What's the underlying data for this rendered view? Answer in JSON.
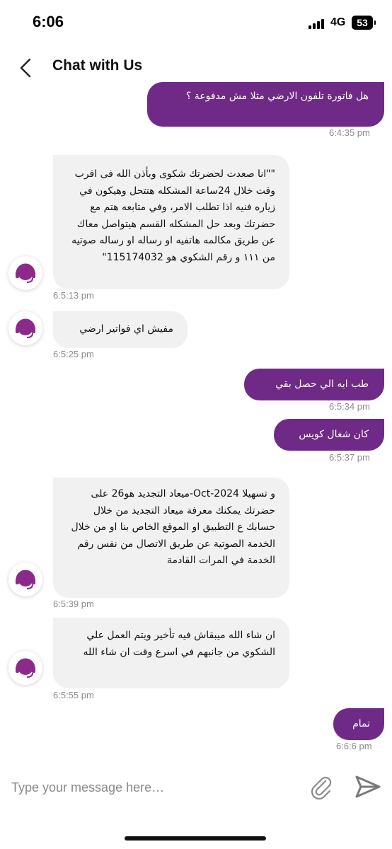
{
  "status_bar": {
    "time": "6:06",
    "network": "4G",
    "battery": "53"
  },
  "header": {
    "title": "Chat with Us",
    "back_icon": "chevron-left-icon"
  },
  "messages": [
    {
      "direction": "out",
      "text": "هل فاتورة تلفون الارضي مثلا مش مدفوعة ؟",
      "time": "6:4:35 pm"
    },
    {
      "direction": "in",
      "text": "\"\"انا صعدت لحضرتك شكوى وبأذن الله فى اقرب وقت خلال 24ساعة المشكله هتتحل وهيكون في زياره فنيه اذا تطلب الامر، وفي متابعه هتم مع حضرتك وبعد حل المشكله القسم هيتواصل معاك عن طريق مكالمه هاتفيه او رساله او رساله صوتيه من ١١١ و رقم الشكوي هو 115174032\"",
      "time": "6:5:13 pm"
    },
    {
      "direction": "in",
      "text": "مفيش اي فواتير ارضي",
      "time": "6:5:25 pm"
    },
    {
      "direction": "out",
      "text": "طب ايه الي حصل بقي",
      "time": "6:5:34 pm"
    },
    {
      "direction": "out",
      "text": "كان شغال كويس",
      "time": "6:5:37 pm"
    },
    {
      "direction": "in",
      "text": "و تسهيلا Oct-2024-ميعاد التجديد هو26 على حضرتك يمكنك معرفة ميعاد التجديد من خلال حسابك ع التطبيق او الموقع الخاص بنا او من خلال الخدمة الصوتية عن طريق الاتصال من نفس رقم الخدمة في المرات القادمة",
      "time": "6:5:39 pm"
    },
    {
      "direction": "in",
      "text": "ان شاء الله ميبقاش فيه تأخير ويتم العمل علي الشكوي من جانبهم في اسرع وقت ان شاء الله",
      "time": "6:5:55 pm"
    },
    {
      "direction": "out",
      "text": "تمام",
      "time": "6:6:6 pm"
    }
  ],
  "agent_avatar_icon": "headset-agent-icon",
  "composer": {
    "placeholder": "Type your message here…",
    "attach_icon": "paperclip-icon",
    "send_icon": "send-icon"
  },
  "colors": {
    "outgoing_bubble": "#6e2a86",
    "incoming_bubble": "#f1f1f1",
    "avatar_icon": "#8c2a8c",
    "timestamp": "#8b8b8b"
  }
}
